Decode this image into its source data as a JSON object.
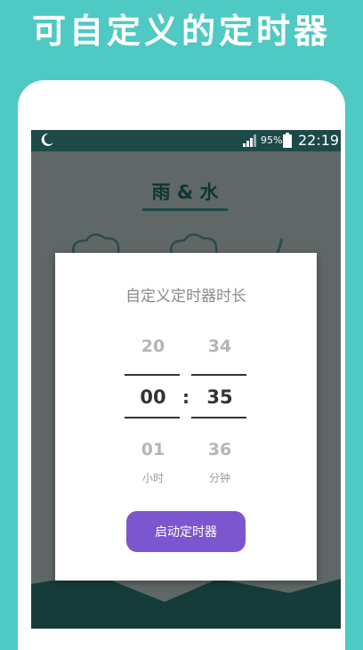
{
  "promo": {
    "title": "可自定义的定时器"
  },
  "status_bar": {
    "battery": "95%",
    "time": "22:19"
  },
  "app": {
    "title": "雨 & 水"
  },
  "dialog": {
    "title": "自定义定时器时长",
    "hours": {
      "prev": "20",
      "current": "00",
      "next": "01",
      "unit": "小时"
    },
    "separator": ":",
    "minutes": {
      "prev": "34",
      "current": "35",
      "next": "36",
      "unit": "分钟"
    },
    "start_button": "启动定时器"
  },
  "colors": {
    "background": "#4ec9c3",
    "status_bar": "#1d4a48",
    "accent_button": "#7c56cf"
  }
}
